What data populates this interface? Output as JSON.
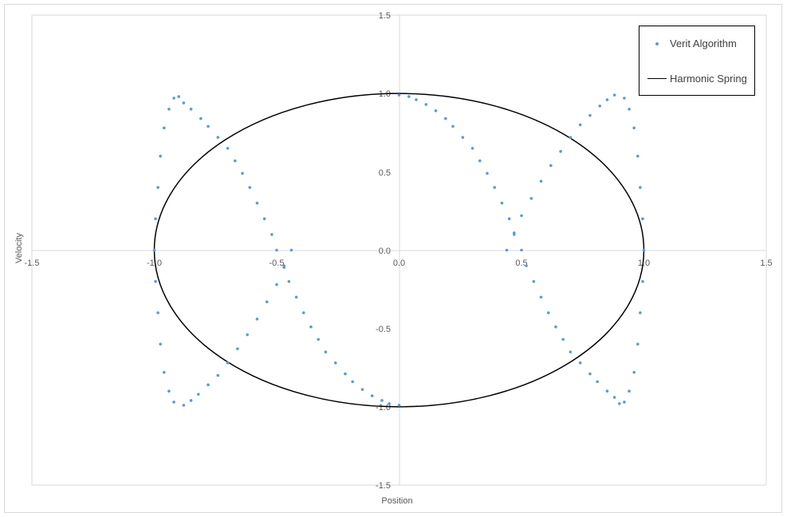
{
  "chart_data": {
    "type": "scatter",
    "xlabel": "Position",
    "ylabel": "Velocity",
    "xlim": [
      -1.5,
      1.5
    ],
    "ylim": [
      -1.5,
      1.5
    ],
    "x_ticks": [
      "-1.5",
      "-1.0",
      "-0.5",
      "0.0",
      "0.5",
      "1.0",
      "1.5"
    ],
    "y_ticks": [
      "-1.5",
      "-1.0",
      "-0.5",
      "0.0",
      "0.5",
      "1.0",
      "1.5"
    ],
    "grid": false,
    "legend_position": "top-right",
    "series": [
      {
        "name": "Verit Algorithm",
        "style": "markers",
        "color": "#5b9bd5",
        "points": [
          [
            0.0,
            0.99
          ],
          [
            0.04,
            0.98
          ],
          [
            0.07,
            0.96
          ],
          [
            0.11,
            0.93
          ],
          [
            0.15,
            0.89
          ],
          [
            0.19,
            0.84
          ],
          [
            0.22,
            0.79
          ],
          [
            0.26,
            0.72
          ],
          [
            0.3,
            0.65
          ],
          [
            0.33,
            0.57
          ],
          [
            0.36,
            0.49
          ],
          [
            0.39,
            0.4
          ],
          [
            0.42,
            0.3
          ],
          [
            0.45,
            0.2
          ],
          [
            0.47,
            0.1
          ],
          [
            0.5,
            0.0
          ],
          [
            0.52,
            -0.1
          ],
          [
            0.55,
            -0.2
          ],
          [
            0.58,
            -0.3
          ],
          [
            0.61,
            -0.4
          ],
          [
            0.64,
            -0.49
          ],
          [
            0.67,
            -0.57
          ],
          [
            0.7,
            -0.65
          ],
          [
            0.74,
            -0.72
          ],
          [
            0.78,
            -0.79
          ],
          [
            0.81,
            -0.84
          ],
          [
            0.85,
            -0.9
          ],
          [
            0.88,
            -0.94
          ],
          [
            0.9,
            -0.98
          ],
          [
            0.92,
            -0.97
          ],
          [
            0.94,
            -0.9
          ],
          [
            0.96,
            -0.78
          ],
          [
            0.975,
            -0.6
          ],
          [
            0.985,
            -0.4
          ],
          [
            0.995,
            -0.2
          ],
          [
            1.0,
            0.0
          ],
          [
            0.995,
            0.2
          ],
          [
            0.985,
            0.4
          ],
          [
            0.975,
            0.6
          ],
          [
            0.96,
            0.78
          ],
          [
            0.94,
            0.9
          ],
          [
            0.92,
            0.97
          ],
          [
            0.88,
            0.99
          ],
          [
            0.85,
            0.96
          ],
          [
            0.82,
            0.92
          ],
          [
            0.78,
            0.86
          ],
          [
            0.74,
            0.8
          ],
          [
            0.7,
            0.72
          ],
          [
            0.66,
            0.63
          ],
          [
            0.62,
            0.54
          ],
          [
            0.58,
            0.44
          ],
          [
            0.54,
            0.33
          ],
          [
            0.5,
            0.22
          ],
          [
            0.47,
            0.11
          ],
          [
            0.44,
            0.0
          ],
          [
            0.0,
            -0.99
          ],
          [
            -0.04,
            -0.98
          ],
          [
            -0.07,
            -0.96
          ],
          [
            -0.11,
            -0.93
          ],
          [
            -0.15,
            -0.89
          ],
          [
            -0.19,
            -0.84
          ],
          [
            -0.22,
            -0.79
          ],
          [
            -0.26,
            -0.72
          ],
          [
            -0.3,
            -0.65
          ],
          [
            -0.33,
            -0.57
          ],
          [
            -0.36,
            -0.49
          ],
          [
            -0.39,
            -0.4
          ],
          [
            -0.42,
            -0.3
          ],
          [
            -0.45,
            -0.2
          ],
          [
            -0.47,
            -0.1
          ],
          [
            -0.5,
            0.0
          ],
          [
            -0.52,
            0.1
          ],
          [
            -0.55,
            0.2
          ],
          [
            -0.58,
            0.3
          ],
          [
            -0.61,
            0.4
          ],
          [
            -0.64,
            0.49
          ],
          [
            -0.67,
            0.57
          ],
          [
            -0.7,
            0.65
          ],
          [
            -0.74,
            0.72
          ],
          [
            -0.78,
            0.79
          ],
          [
            -0.81,
            0.84
          ],
          [
            -0.85,
            0.9
          ],
          [
            -0.88,
            0.94
          ],
          [
            -0.9,
            0.98
          ],
          [
            -0.92,
            0.97
          ],
          [
            -0.94,
            0.9
          ],
          [
            -0.96,
            0.78
          ],
          [
            -0.975,
            0.6
          ],
          [
            -0.985,
            0.4
          ],
          [
            -0.995,
            0.2
          ],
          [
            -1.0,
            0.0
          ],
          [
            -0.995,
            -0.2
          ],
          [
            -0.985,
            -0.4
          ],
          [
            -0.975,
            -0.6
          ],
          [
            -0.96,
            -0.78
          ],
          [
            -0.94,
            -0.9
          ],
          [
            -0.92,
            -0.97
          ],
          [
            -0.88,
            -0.99
          ],
          [
            -0.85,
            -0.96
          ],
          [
            -0.82,
            -0.92
          ],
          [
            -0.78,
            -0.86
          ],
          [
            -0.74,
            -0.8
          ],
          [
            -0.7,
            -0.72
          ],
          [
            -0.66,
            -0.63
          ],
          [
            -0.62,
            -0.54
          ],
          [
            -0.58,
            -0.44
          ],
          [
            -0.54,
            -0.33
          ],
          [
            -0.5,
            -0.22
          ],
          [
            -0.47,
            -0.11
          ],
          [
            -0.44,
            0.0
          ]
        ]
      },
      {
        "name": "Harmonic Spring",
        "style": "line",
        "color": "#000000",
        "shape": "circle",
        "radius": 1.0
      }
    ]
  }
}
